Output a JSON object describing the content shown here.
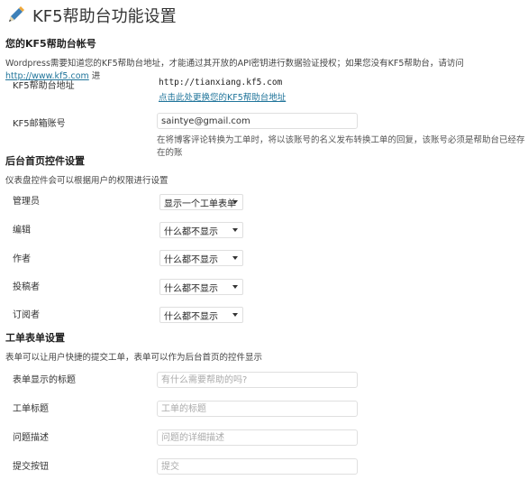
{
  "header": {
    "title": "KF5帮助台功能设置",
    "icon": "pencil-icon"
  },
  "account": {
    "heading": "您的KF5帮助台帐号",
    "desc_prefix": "Wordpress需要知道您的KF5帮助台地址，才能通过其开放的API密钥进行数据验证授权；如果您没有KF5帮助台，请访问",
    "desc_link": "http://www.kf5.com",
    "desc_suffix": "进",
    "address_label": "KF5帮助台地址",
    "address_value": "http://tianxiang.kf5.com",
    "change_link": "点击此处更换您的KF5帮助台地址",
    "email_label": "KF5邮箱账号",
    "email_value": "saintye@gmail.com",
    "email_help": "在将博客评论转换为工单时，将以该账号的名义发布转换工单的回复，该账号必须是帮助台已经存在的账"
  },
  "widget": {
    "heading": "后台首页控件设置",
    "desc": "仪表盘控件会可以根据用户的权限进行设置",
    "roles": [
      {
        "label": "管理员",
        "value": "显示一个工单表单"
      },
      {
        "label": "编辑",
        "value": "什么都不显示"
      },
      {
        "label": "作者",
        "value": "什么都不显示"
      },
      {
        "label": "投稿者",
        "value": "什么都不显示"
      },
      {
        "label": "订阅者",
        "value": "什么都不显示"
      }
    ]
  },
  "form": {
    "heading": "工单表单设置",
    "desc": "表单可以让用户快捷的提交工单，表单可以作为后台首页的控件显示",
    "fields": [
      {
        "label": "表单显示的标题",
        "placeholder": "有什么需要帮助的吗?"
      },
      {
        "label": "工单标题",
        "placeholder": "工单的标题"
      },
      {
        "label": "问题描述",
        "placeholder": "问题的详细描述"
      },
      {
        "label": "提交按钮",
        "placeholder": "提交"
      }
    ]
  }
}
